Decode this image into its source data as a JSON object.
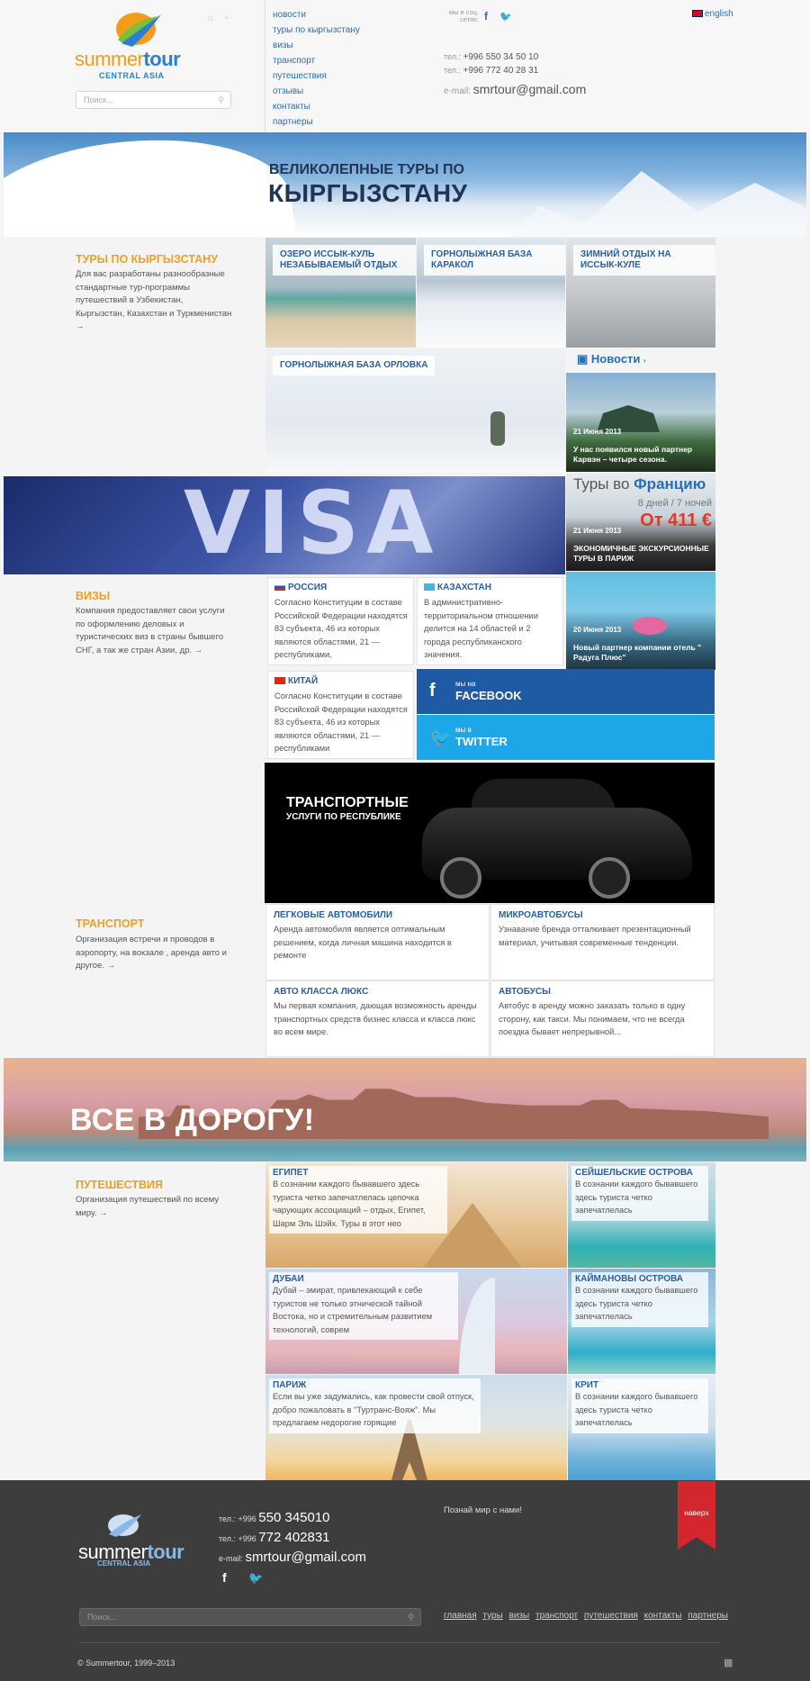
{
  "header": {
    "logo": {
      "word1": "summer",
      "word2": "tour",
      "sub": "CENTRAL ASIA"
    },
    "search_placeholder": "Поиск...",
    "nav": [
      "новости",
      "туры по кыргызстану",
      "визы",
      "транспорт",
      "путешествия",
      "отзывы",
      "контакты",
      "партнеры"
    ],
    "social_label": "мы в соц. сетях:",
    "phone1_label": "тел.:",
    "phone1": "+996 550 34 50 10",
    "phone2_label": "тел.:",
    "phone2": "+996 772 40 28 31",
    "email_label": "e-mail:",
    "email": "smrtour@gmail.com",
    "language": "english"
  },
  "hero": {
    "line1": "ВЕЛИКОЛЕПНЫЕ ТУРЫ ПО",
    "line2": "КЫРГЫЗСТАНУ"
  },
  "tours": {
    "title": "ТУРЫ ПО КЫРГЫЗСТАНУ",
    "text": "Для вас разработаны разнообразные стандартные тур-программы путешествий в Узбекистан, Кыргызстан, Казахстан и Туркменистан →",
    "tiles": [
      "ОЗЕРО ИССЫК-КУЛЬ НЕЗАБЫВАЕМЫЙ ОТДЫХ",
      "ГОРНОЛЫЖНАЯ БАЗА КАРАКОЛ",
      "ЗИМНИЙ ОТДЫХ НА ИССЫК-КУЛЕ",
      "ГОРНОЛЫЖНАЯ БАЗА ОРЛОВКА"
    ]
  },
  "news": {
    "title": "Новости",
    "items": [
      {
        "date": "21 Июня 2013",
        "text": "У нас появился новый партнер Карвэн – четыре сезона."
      },
      {
        "date": "21 Июня 2013",
        "text": "ЭКОНОМИЧНЫЕ ЭКСКУРСИОННЫЕ ТУРЫ В ПАРИЖ",
        "promo1": "Туры во",
        "promo2": "Францию",
        "promo3": "8 дней / 7 ночей",
        "price": "От 411 €"
      },
      {
        "date": "20 Июня 2013",
        "text": "Новый партнер компании отель \" Радуга Плюс\""
      }
    ]
  },
  "visa": {
    "banner": "VISA",
    "title": "ВИЗЫ",
    "text": "Компания предоставляет свои услуги по оформлению деловых и туристических виз в страны бывшего СНГ, а так же стран Азии, др. →",
    "countries": [
      {
        "name": "РОССИЯ",
        "text": "Согласно Конституции в составе Российской Федерации находятся 83 субъекта, 46 из которых являются областями, 21 — республиками,"
      },
      {
        "name": "КАЗАХСТАН",
        "text": "В административно-территориальном отношении делится на 14 областей и 2 города республиканского значения."
      },
      {
        "name": "КИТАЙ",
        "text": "Согласно Конституции в составе Российской Федерации находятся 83 субъекта, 46 из которых являются областями, 21 — республиками"
      }
    ],
    "facebook": {
      "small": "мы на",
      "big": "FACEBOOK"
    },
    "twitter": {
      "small": "мы в",
      "big": "TWITTER"
    }
  },
  "transport": {
    "banner1": "ТРАНСПОРТНЫЕ",
    "banner2": "УСЛУГИ ПО РЕСПУБЛИКЕ",
    "title": "ТРАНСПОРТ",
    "text": "Организация встречи и проводов в аэропорту, на вокзале , аренда авто и другое. →",
    "cells": [
      {
        "name": "ЛЕГКОВЫЕ АВТОМОБИЛИ",
        "text": "Аренда автомобиля является оптимальным решением, когда личная машина находится в ремонте"
      },
      {
        "name": "МИКРОАВТОБУСЫ",
        "text": "Узнавание бренда отталкивает презентационный материал, учитывая современные тенденции."
      },
      {
        "name": "АВТО КЛАССА ЛЮКС",
        "text": "Мы первая компания, дающая возможность аренды транспортных средств бизнес класса и класса люкс во всем мире."
      },
      {
        "name": "АВТОБУСЫ",
        "text": "Автобус в аренду можно заказать только в одну сторону, как такси. Мы понимаем, что не всегда поездка бывает непрерывной..."
      }
    ]
  },
  "travel": {
    "banner": "ВСЕ В ДОРОГУ!",
    "title": "ПУТЕШЕСТВИЯ",
    "text": "Организация путешествий по всему миру. →",
    "destinations": [
      {
        "name": "ЕГИПЕТ",
        "text": "В сознании каждого бывавшего здесь туриста четко запечатлелась цепочка чарующих ассоциаций – отдых, Египет, Шарм Эль Шэйх. Туры в этот нео"
      },
      {
        "name": "СЕЙШЕЛЬСКИЕ ОСТРОВА",
        "text": "В сознании каждого бывавшего здесь туриста четко запечатлелась"
      },
      {
        "name": "ДУБАИ",
        "text": "Дубай – эмират, привлекающий к себе туристов не только этнической тайной Востока, но и стремительным развитием технологий, соврем"
      },
      {
        "name": "КАЙМАНОВЫ ОСТРОВА",
        "text": "В сознании каждого бывавшего здесь туриста четко запечатлелась"
      },
      {
        "name": "ПАРИЖ",
        "text": "Если вы уже задумались, как провести свой отпуск, добро пожаловать в \"Туртранс-Вояж\". Мы предлагаем недорогие горящие"
      },
      {
        "name": "КРИТ",
        "text": "В сознании каждого бывавшего здесь туриста четко запечатлелась"
      }
    ]
  },
  "footer": {
    "logo": {
      "word1": "summer",
      "word2": "tour",
      "sub": "CENTRAL ASIA"
    },
    "phone1_label": "тел.: +996",
    "phone1": "550 345010",
    "phone2_label": "тел.: +996",
    "phone2": "772 402831",
    "email_label": "e-mail:",
    "email": "smrtour@gmail.com",
    "slogan": "Познай мир с нами!",
    "top_button": "наверх",
    "search_placeholder": "Поиск...",
    "links": [
      "главная",
      "туры",
      "визы",
      "транспорт",
      "путешествия",
      "контакты",
      "партнеры"
    ],
    "copyright": "© Summertour, 1999–2013"
  },
  "colors": {
    "accent_orange": "#f0a020",
    "link_blue": "#2a6db5",
    "facebook": "#1f5aa5",
    "twitter": "#1da7e8",
    "ribbon": "#d4262e"
  }
}
